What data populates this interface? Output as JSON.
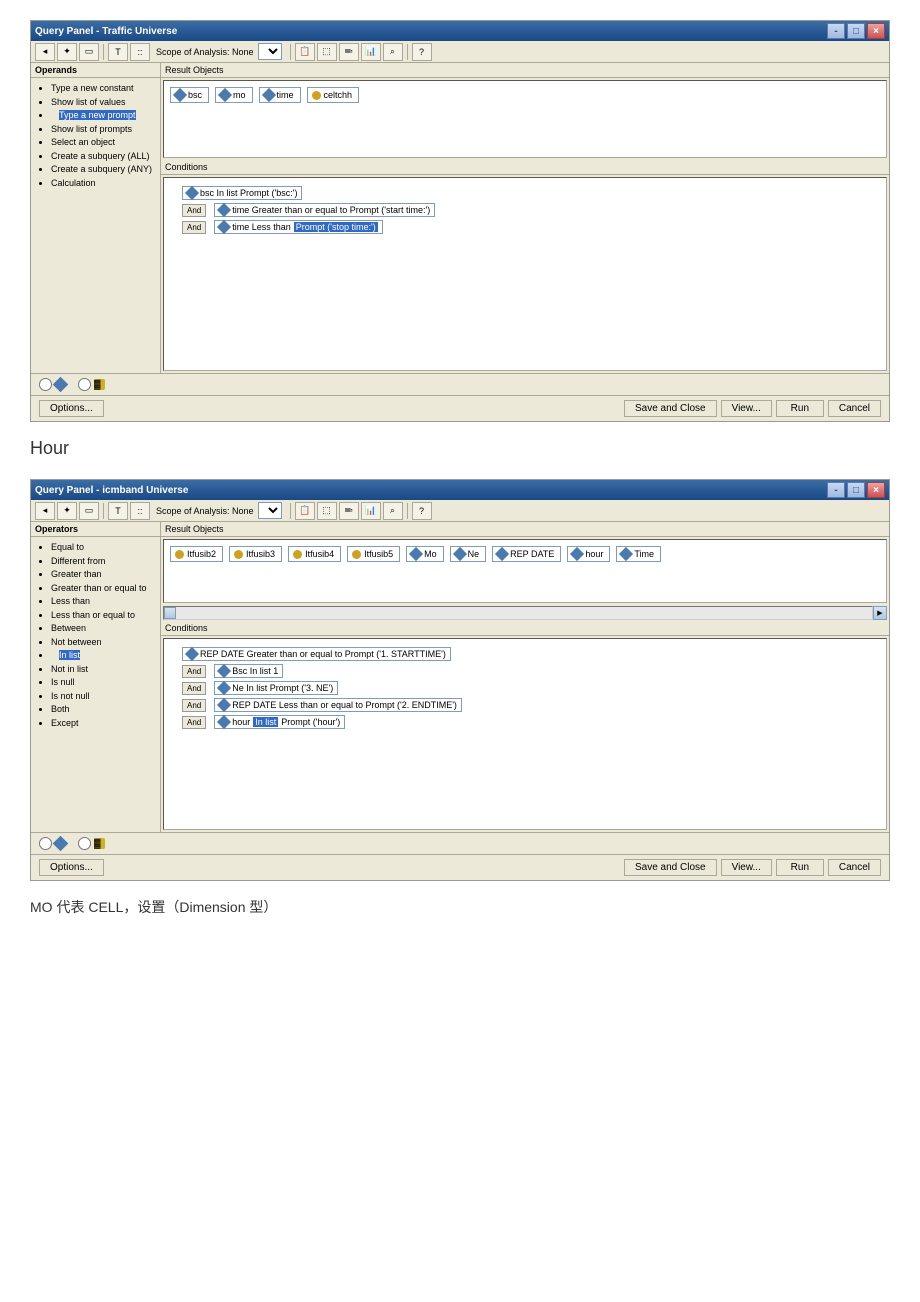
{
  "doc": {
    "heading": "Hour",
    "footer_note": "MO 代表 CELL，设置（Dimension 型）"
  },
  "panel1": {
    "title": "Query Panel - Traffic Universe",
    "scope_label": "Scope of Analysis: None",
    "left_header": "Operands",
    "operands": [
      {
        "label": "Type a new constant"
      },
      {
        "label": "Show list of values"
      },
      {
        "label": "Type a new prompt",
        "hl": true
      },
      {
        "label": "Show list of prompts"
      },
      {
        "label": "Select an object"
      },
      {
        "label": "Create a subquery (ALL)"
      },
      {
        "label": "Create a subquery (ANY)"
      },
      {
        "label": "Calculation"
      }
    ],
    "result_header": "Result Objects",
    "result_objects": [
      {
        "type": "dim",
        "label": "bsc"
      },
      {
        "type": "dim",
        "label": "mo"
      },
      {
        "type": "dim",
        "label": "time"
      },
      {
        "type": "meas",
        "label": "celtchh"
      }
    ],
    "cond_header": "Conditions",
    "conditions": [
      {
        "indent": 0,
        "parts": [
          {
            "icon": "dim",
            "text": "bsc In list Prompt ('bsc:')"
          }
        ]
      },
      {
        "indent": 0,
        "and": true,
        "parts": [
          {
            "icon": "dim",
            "text": "time Greater than or equal to Prompt ('start time:')"
          }
        ]
      },
      {
        "indent": 0,
        "and": true,
        "parts": [
          {
            "icon": "dim",
            "prefix": "time Less than ",
            "hl": "Prompt ('stop time:')"
          }
        ]
      }
    ],
    "and_label": "And",
    "options_btn": "Options...",
    "buttons": {
      "save": "Save and Close",
      "view": "View...",
      "run": "Run",
      "cancel": "Cancel"
    }
  },
  "panel2": {
    "title": "Query Panel - icmband Universe",
    "scope_label": "Scope of Analysis: None",
    "left_header": "Operators",
    "operators": [
      {
        "label": "Equal to"
      },
      {
        "label": "Different from"
      },
      {
        "label": "Greater than"
      },
      {
        "label": "Greater than or equal to"
      },
      {
        "label": "Less than"
      },
      {
        "label": "Less than or equal to"
      },
      {
        "label": "Between"
      },
      {
        "label": "Not between"
      },
      {
        "label": "In list",
        "hl": true
      },
      {
        "label": "Not in list"
      },
      {
        "label": "Is null"
      },
      {
        "label": "Is not null"
      },
      {
        "label": "Both"
      },
      {
        "label": "Except"
      }
    ],
    "result_header": "Result Objects",
    "result_objects": [
      {
        "type": "meas",
        "label": "Itfusib2"
      },
      {
        "type": "meas",
        "label": "Itfusib3"
      },
      {
        "type": "meas",
        "label": "Itfusib4"
      },
      {
        "type": "meas",
        "label": "Itfusib5"
      },
      {
        "type": "dim",
        "label": "Mo"
      },
      {
        "type": "dim",
        "label": "Ne"
      },
      {
        "type": "dim",
        "label": "REP DATE"
      },
      {
        "type": "dim",
        "label": "hour"
      },
      {
        "type": "dim",
        "label": "Time"
      }
    ],
    "cond_header": "Conditions",
    "conditions": [
      {
        "indent": 0,
        "parts": [
          {
            "icon": "dim",
            "text": "REP DATE Greater than or equal to Prompt ('1. STARTTIME')"
          }
        ]
      },
      {
        "indent": 0,
        "and": true,
        "parts": [
          {
            "icon": "dim",
            "text": "Bsc In list 1"
          }
        ]
      },
      {
        "indent": 0,
        "and": true,
        "parts": [
          {
            "icon": "dim",
            "text": "Ne In list Prompt ('3. NE')"
          }
        ]
      },
      {
        "indent": 0,
        "and": true,
        "parts": [
          {
            "icon": "dim",
            "text": "REP DATE Less than or equal to Prompt ('2. ENDTIME')"
          }
        ]
      },
      {
        "indent": 0,
        "and": true,
        "parts": [
          {
            "icon": "dim",
            "prefix": "hour ",
            "hl": "In list",
            "suffix": " Prompt ('hour')"
          }
        ]
      }
    ],
    "and_label": "And",
    "options_btn": "Options...",
    "buttons": {
      "save": "Save and Close",
      "view": "View...",
      "run": "Run",
      "cancel": "Cancel"
    }
  }
}
